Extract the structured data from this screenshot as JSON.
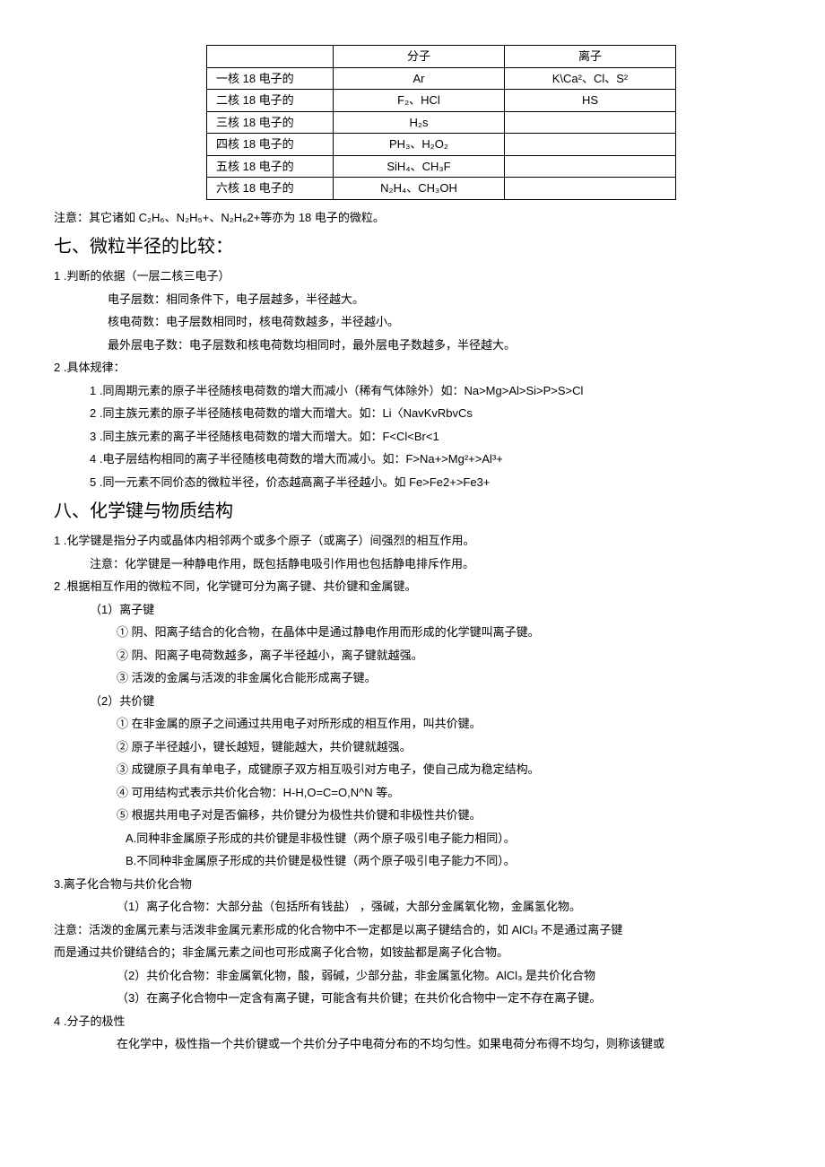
{
  "table": {
    "header": {
      "c1": "",
      "c2": "分子",
      "c3": "离子"
    },
    "rows": [
      {
        "label": "一核 18 电子的",
        "mol": "Ar",
        "ion": "K\\Ca²、Cl、S²"
      },
      {
        "label": "二核 18 电子的",
        "mol": "F₂、HCl",
        "ion": "HS"
      },
      {
        "label": "三核 18 电子的",
        "mol": "H₂s",
        "ion": ""
      },
      {
        "label": "四核 18 电子的",
        "mol": "PH₃、H₂O₂",
        "ion": ""
      },
      {
        "label": "五核 18 电子的",
        "mol": "SiH₄、CH₃F",
        "ion": ""
      },
      {
        "label": "六核 18 电子的",
        "mol": "N₂H₄、CH₃OH",
        "ion": ""
      }
    ]
  },
  "note1": "注意：其它诸如 C₂H₆、N₂H₅+、N₂H₆2+等亦为 18 电子的微粒。",
  "h7": "七、微粒半径的比较：",
  "s7": {
    "p1": "1 .判断的依据（一层二核三电子）",
    "p1a": "电子层数：相同条件下，电子层越多，半径越大。",
    "p1b": "核电荷数：电子层数相同时，核电荷数越多，半径越小。",
    "p1c": "最外层电子数：电子层数和核电荷数均相同时，最外层电子数越多，半径越大。",
    "p2": "2 .具体规律：",
    "p2a": "1 .同周期元素的原子半径随核电荷数的增大而减小（稀有气体除外）如：Na>Mg>Al>Si>P>S>Cl",
    "p2b": "2 .同主族元素的原子半径随核电荷数的增大而增大。如：Li〈NavKvRbvCs",
    "p2c": "3 .同主族元素的离子半径随核电荷数的增大而增大。如：F<Cl<Br<1",
    "p2d": "4 .电子层结构相同的离子半径随核电荷数的增大而减小。如：F>Na+>Mg²+>Al³+",
    "p2e": "5 .同一元素不同价态的微粒半径，价态越高离子半径越小。如 Fe>Fe2+>Fe3+"
  },
  "h8": "八、化学键与物质结构",
  "s8": {
    "p1": "1 .化学键是指分子内或晶体内相邻两个或多个原子（或离子）间强烈的相互作用。",
    "p1n": "注意：化学键是一种静电作用，既包括静电吸引作用也包括静电排斥作用。",
    "p2": "2 .根据相互作用的微粒不同，化学键可分为离子键、共价键和金属键。",
    "p2_1": "（1）离子键",
    "p2_1a": "①  阴、阳离子结合的化合物，在晶体中是通过静电作用而形成的化学键叫离子键。",
    "p2_1b": "②  阴、阳离子电荷数越多，离子半径越小，离子键就越强。",
    "p2_1c": "③  活泼的金属与活泼的非金属化合能形成离子键。",
    "p2_2": "（2）共价键",
    "p2_2a": "①  在非金属的原子之间通过共用电子对所形成的相互作用，叫共价键。",
    "p2_2b": "②  原子半径越小，键长越短，键能越大，共价键就越强。",
    "p2_2c": "③  成键原子具有单电子，成键原子双方相互吸引对方电子，使自己成为稳定结构。",
    "p2_2d": "④  可用结构式表示共价化合物：H-H,O=C=O,N^N 等。",
    "p2_2e": "⑤  根据共用电子对是否偏移，共价键分为极性共价键和非极性共价键。",
    "p2_2A": "A.同种非金属原子形成的共价键是非极性键（两个原子吸引电子能力相同）。",
    "p2_2B": "B.不同种非金属原子形成的共价键是极性键（两个原子吸引电子能力不同）。",
    "p3": "3.离子化合物与共价化合物",
    "p3_1": "（1）离子化合物：大部分盐（包括所有钱盐）    ，强碱，大部分金属氧化物，金属氢化物。",
    "p3n": "注意：活泼的金属元素与活泼非金属元素形成的化合物中不一定都是以离子键结合的，如 AlCl₃ 不是通过离子键",
    "p3n2": "而是通过共价键结合的；非金属元素之间也可形成离子化合物，如铵盐都是离子化合物。",
    "p3_2": "（2）共价化合物：非金属氧化物，酸，弱碱，少部分盐，非金属氢化物。AlCl₃ 是共价化合物",
    "p3_3": "（3）在离子化合物中一定含有离子键，可能含有共价键；在共价化合物中一定不存在离子键。",
    "p4": "4  .分子的极性",
    "p4a": "在化学中，极性指一个共价键或一个共价分子中电荷分布的不均匀性。如果电荷分布得不均匀，则称该键或"
  }
}
